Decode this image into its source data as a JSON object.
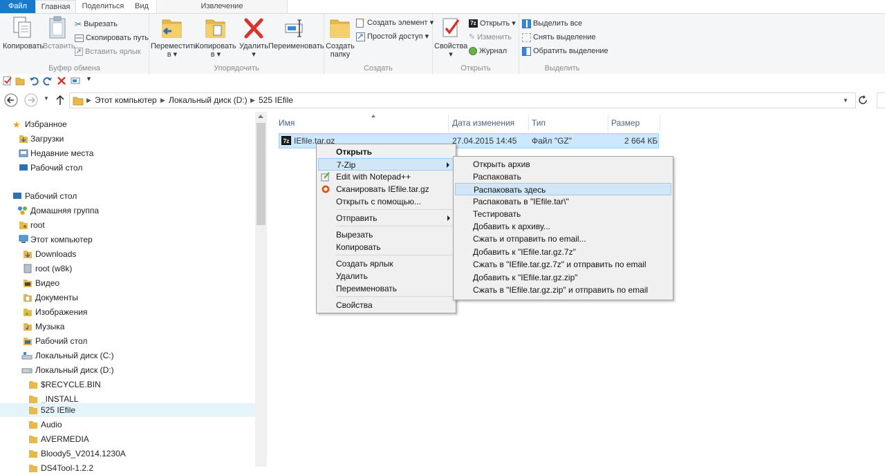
{
  "ribbon": {
    "tabs": [
      "Файл",
      "Главная",
      "Поделиться",
      "Вид"
    ],
    "context_tab": "Извлечение",
    "clipboard": {
      "copy": "Копировать",
      "paste": "Вставить",
      "cut": "Вырезать",
      "copy_path": "Скопировать путь",
      "paste_shortcut": "Вставить ярлык",
      "label": "Буфер обмена"
    },
    "organize": {
      "move_to_1": "Переместить",
      "move_to_2": "в ▾",
      "copy_to_1": "Копировать",
      "copy_to_2": "в ▾",
      "delete_1": "Удалить",
      "delete_2": "▾",
      "rename": "Переименовать",
      "label": "Упорядочить"
    },
    "create": {
      "new_folder_1": "Создать",
      "new_folder_2": "папку",
      "new_item": "Создать элемент ▾",
      "easy_access": "Простой доступ ▾",
      "label": "Создать"
    },
    "open": {
      "properties_1": "Свойства",
      "properties_2": "▾",
      "open": "Открыть ▾",
      "edit": "Изменить",
      "history": "Журнал",
      "label": "Открыть"
    },
    "select": {
      "select_all": "Выделить все",
      "select_none": "Снять выделение",
      "invert": "Обратить выделение",
      "label": "Выделить"
    }
  },
  "address": {
    "crumbs": [
      "Этот компьютер",
      "Локальный диск (D:)",
      "525 IEfile"
    ]
  },
  "nav": {
    "items": [
      "Избранное",
      "Загрузки",
      "Недавние места",
      "Рабочий стол",
      "Рабочий стол",
      "Домашняя группа",
      "root",
      "Этот компьютер",
      "Downloads",
      "root (w8k)",
      "Видео",
      "Документы",
      "Изображения",
      "Музыка",
      "Рабочий стол",
      "Локальный диск (C:)",
      "Локальный диск (D:)",
      "$RECYCLE.BIN",
      "_INSTALL",
      "525 IEfile",
      "Audio",
      "AVERMEDIA",
      "Bloody5_V2014.1230A",
      "DS4Tool-1.2.2"
    ]
  },
  "list": {
    "columns": [
      "Имя",
      "Дата изменения",
      "Тип",
      "Размер"
    ],
    "file": {
      "name": "IEfile.tar.gz",
      "date": "27.04.2015 14:45",
      "type": "Файл \"GZ\"",
      "size": "2 664 КБ"
    }
  },
  "context_menu": {
    "items": [
      "Открыть",
      "7-Zip",
      "Edit with Notepad++",
      "Сканировать IEfile.tar.gz",
      "Открыть с помощью...",
      "Отправить",
      "Вырезать",
      "Копировать",
      "Создать ярлык",
      "Удалить",
      "Переименовать",
      "Свойства"
    ]
  },
  "submenu": {
    "items": [
      "Открыть архив",
      "Распаковать",
      "Распаковать здесь",
      "Распаковать в \"IEfile.tar\\\"",
      "Тестировать",
      "Добавить к архиву...",
      "Сжать и отправить по email...",
      "Добавить к \"IEfile.tar.gz.7z\"",
      "Сжать в \"IEfile.tar.gz.7z\" и отправить по email",
      "Добавить к \"IEfile.tar.gz.zip\"",
      "Сжать в \"IEfile.tar.gz.zip\" и отправить по email"
    ]
  },
  "colors": {
    "file_tab": "#1979ca",
    "selection": "#cce8ff",
    "menu_highlight": "#d1e7f8",
    "folder": "#e8b84a"
  }
}
